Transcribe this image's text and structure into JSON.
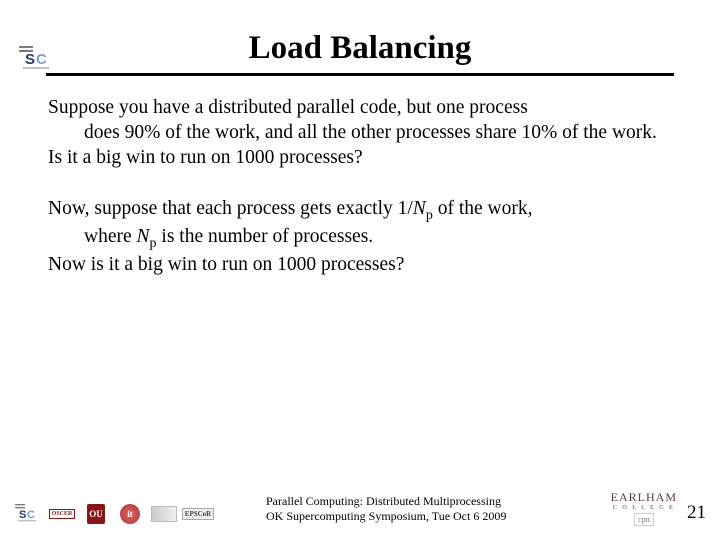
{
  "title": "Load Balancing",
  "body": {
    "p1_a": "Suppose you have a distributed parallel code, but one process",
    "p1_b": "does 90% of the work, and all the other processes share 10% of the work.",
    "p1_c": "Is it a big win to run on 1000 processes?",
    "p2_a": "Now, suppose that each process gets exactly 1/",
    "p2_a_tail": " of the work,",
    "p2_b_pre": "where ",
    "p2_b_post": " is the number of processes.",
    "p2_c": "Now is it a big win to run on 1000 processes?",
    "N": "N",
    "p": "p"
  },
  "footer": {
    "line1": "Parallel Computing: Distributed Multiprocessing",
    "line2": "OK Supercomputing Symposium, Tue Oct 6 2009",
    "page": "21",
    "earlham": "EARLHAM",
    "earlham_sub": "C O L L E G E"
  },
  "logos": {
    "sc": "SC",
    "oscer": "OSCER",
    "ou": "OU",
    "it": "it",
    "epscor": "EPSCoR",
    "cpn": "cpn"
  }
}
